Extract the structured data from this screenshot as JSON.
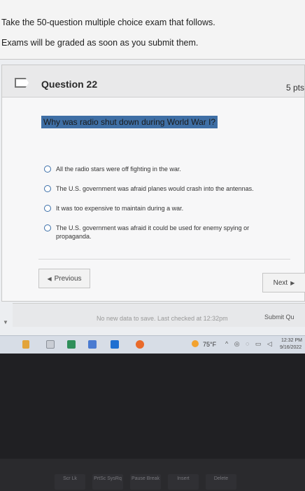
{
  "instructions": {
    "line1": "Take the 50-question multiple choice exam that follows.",
    "line2": "Exams will be graded as soon as you submit them."
  },
  "question": {
    "title": "Question 22",
    "points": "5 pts",
    "text": "Why was radio shut down during World War I?",
    "answers": [
      "All the radio stars were off fighting in the war.",
      "The U.S. government was afraid planes would crash into the antennas.",
      "It was too expensive to maintain during a war.",
      "The U.S. government was afraid it could be used for enemy spying or propaganda."
    ]
  },
  "navigation": {
    "previous_label": "Previous",
    "next_label": "Next"
  },
  "status": {
    "text": "No new data to save. Last checked at 12:32pm",
    "submit_label": "Submit Qu"
  },
  "taskbar": {
    "weather_temp": "75°F",
    "clock_time": "12:32 PM",
    "clock_date": "9/16/2022"
  },
  "keyboard": {
    "keys": [
      "Scr Lk",
      "PrtSc SysRq",
      "Pause Break",
      "Insert",
      "Delete"
    ]
  }
}
